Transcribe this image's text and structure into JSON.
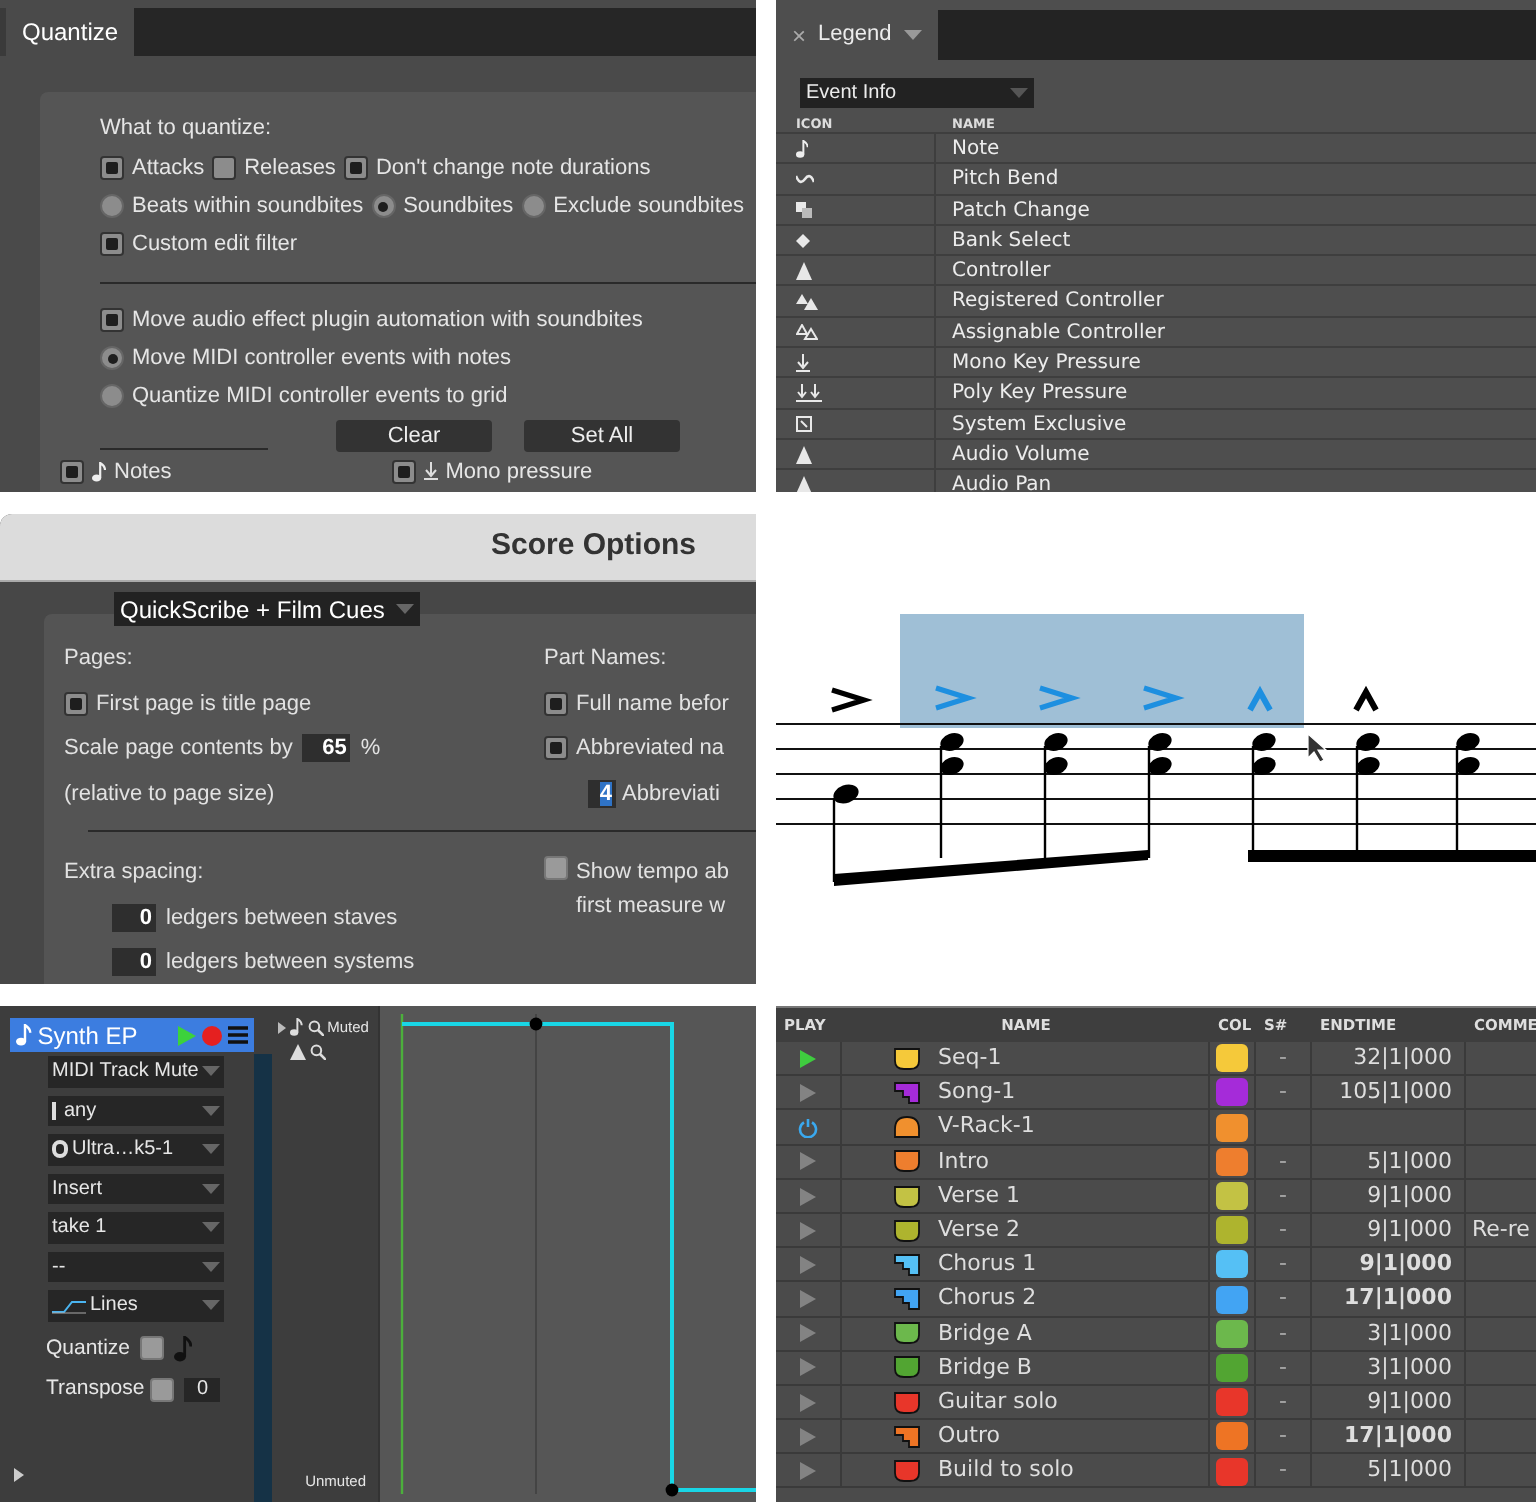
{
  "quantize": {
    "tab": "Quantize",
    "heading": "What to quantize:",
    "rows": [
      {
        "options": [
          {
            "kind": "checkbox",
            "label": "Attacks",
            "checked": true
          },
          {
            "kind": "checkbox",
            "label": "Releases",
            "checked": false
          },
          {
            "kind": "checkbox",
            "label": "Don't change note durations",
            "checked": true
          }
        ]
      },
      {
        "options": [
          {
            "kind": "radio",
            "label": "Beats within soundbites",
            "selected": false
          },
          {
            "kind": "radio",
            "label": "Soundbites",
            "selected": true
          },
          {
            "kind": "radio",
            "label": "Exclude soundbites",
            "selected": false
          }
        ]
      },
      {
        "options": [
          {
            "kind": "checkbox",
            "label": "Custom edit filter",
            "checked": true
          }
        ]
      }
    ],
    "rows_2": [
      {
        "options": [
          {
            "kind": "checkbox",
            "label": "Move audio effect plugin automation with soundbites",
            "checked": true
          }
        ]
      },
      {
        "options": [
          {
            "kind": "radio",
            "label": "Move MIDI controller events with notes",
            "selected": true
          }
        ]
      },
      {
        "options": [
          {
            "kind": "radio",
            "label": "Quantize MIDI controller events to grid",
            "selected": false
          }
        ]
      }
    ],
    "buttons": [
      "Clear",
      "Set All"
    ],
    "event_filters": [
      {
        "label": "Notes",
        "kind": "note",
        "checked": true
      },
      {
        "label": "Mono pressure",
        "kind": "mono",
        "checked": true
      }
    ]
  },
  "legend": {
    "tab": "Legend",
    "close": "×",
    "dropdown": "Event Info",
    "columns": [
      "ICON",
      "NAME"
    ],
    "rows": [
      {
        "kind": "note",
        "name": "Note"
      },
      {
        "kind": "bend",
        "name": "Pitch Bend"
      },
      {
        "kind": "patch",
        "name": "Patch Change"
      },
      {
        "kind": "diamond",
        "name": "Bank Select"
      },
      {
        "kind": "triangle",
        "name": "Controller"
      },
      {
        "kind": "registered",
        "name": "Registered Controller"
      },
      {
        "kind": "assignable",
        "name": "Assignable Controller"
      },
      {
        "kind": "mono",
        "name": "Mono Key Pressure"
      },
      {
        "kind": "poly",
        "name": "Poly Key Pressure"
      },
      {
        "kind": "sysex",
        "name": "System Exclusive"
      },
      {
        "kind": "triangle",
        "name": "Audio Volume"
      },
      {
        "kind": "triangle",
        "name": "Audio Pan"
      }
    ]
  },
  "score_options": {
    "title": "Score Options",
    "preset": "QuickScribe + Film Cues",
    "pages": {
      "heading": "Pages:",
      "first_page": {
        "label": "First page is title page",
        "checked": true
      },
      "scale_label": "Scale page contents by",
      "scale_value": "65",
      "scale_unit": "%",
      "scale_note": "(relative to page size)"
    },
    "part_names": {
      "heading": "Part Names:",
      "options": [
        {
          "label": "Full name befor",
          "checked": true
        },
        {
          "label": "Abbreviated na",
          "checked": true
        }
      ],
      "abbrev_value": "4",
      "abbrev_label": "Abbreviati"
    },
    "extra_spacing": {
      "heading": "Extra spacing:",
      "fields": [
        {
          "value": "0",
          "label": "ledgers between staves"
        },
        {
          "value": "0",
          "label": "ledgers between systems"
        }
      ]
    },
    "show_tempo": {
      "label": "Show tempo ab",
      "label_2": "first measure w",
      "checked": false
    }
  },
  "inspector": {
    "track": "Synth EP",
    "dropdowns": [
      {
        "kind": "plain",
        "value": "MIDI Track Mute"
      },
      {
        "kind": "input",
        "value": "any"
      },
      {
        "kind": "output",
        "value": "Ultra…k5-1"
      },
      {
        "kind": "plain",
        "value": "Insert"
      },
      {
        "kind": "plain",
        "value": "take 1"
      },
      {
        "kind": "plain",
        "value": "--"
      },
      {
        "kind": "lines",
        "value": "Lines"
      }
    ],
    "quantize": {
      "label": "Quantize",
      "checked": false
    },
    "transpose": {
      "label": "Transpose",
      "checked": false,
      "value": "0"
    },
    "muted": "Muted",
    "unmuted": "Unmuted"
  },
  "tracks": {
    "columns": [
      "PLAY",
      "NAME",
      "COL",
      "S#",
      "ENDTIME",
      "COMME"
    ],
    "rows": [
      {
        "play": {
          "kind": "play",
          "active": true
        },
        "clip": {
          "kind": "cup"
        },
        "name": "Seq-1",
        "color": "#f5c93a",
        "s": "-",
        "endtime": "32|1|000",
        "bold": false
      },
      {
        "play": {
          "kind": "play",
          "active": false
        },
        "clip": {
          "kind": "step"
        },
        "name": "Song-1",
        "color": "#a52bd9",
        "s": "-",
        "endtime": "105|1|000",
        "bold": false
      },
      {
        "play": {
          "kind": "power"
        },
        "clip": {
          "kind": "dome"
        },
        "name": "V-Rack-1",
        "color": "#f0902e"
      },
      {
        "play": {
          "kind": "play",
          "active": false
        },
        "clip": {
          "kind": "cup"
        },
        "name": "Intro",
        "color": "#ee7e2e",
        "s": "-",
        "endtime": "5|1|000",
        "bold": false
      },
      {
        "play": {
          "kind": "play",
          "active": false
        },
        "clip": {
          "kind": "cup"
        },
        "name": "Verse 1",
        "color": "#c3c244",
        "s": "-",
        "endtime": "9|1|000",
        "bold": false
      },
      {
        "play": {
          "kind": "play",
          "active": false
        },
        "clip": {
          "kind": "cup"
        },
        "name": "Verse 2",
        "color": "#aeb42e",
        "s": "-",
        "endtime": "9|1|000",
        "bold": false,
        "comment": "Re-re"
      },
      {
        "play": {
          "kind": "play",
          "active": false
        },
        "clip": {
          "kind": "step"
        },
        "name": "Chorus 1",
        "color": "#55c0f5",
        "s": "-",
        "endtime": "9|1|000",
        "bold": true
      },
      {
        "play": {
          "kind": "play",
          "active": false
        },
        "clip": {
          "kind": "step"
        },
        "name": "Chorus 2",
        "color": "#42a4f3",
        "s": "-",
        "endtime": "17|1|000",
        "bold": true
      },
      {
        "play": {
          "kind": "play",
          "active": false
        },
        "clip": {
          "kind": "cup"
        },
        "name": "Bridge A",
        "color": "#6cb84c",
        "s": "-",
        "endtime": "3|1|000",
        "bold": false
      },
      {
        "play": {
          "kind": "play",
          "active": false
        },
        "clip": {
          "kind": "cup"
        },
        "name": "Bridge B",
        "color": "#52a532",
        "s": "-",
        "endtime": "3|1|000",
        "bold": false
      },
      {
        "play": {
          "kind": "play",
          "active": false
        },
        "clip": {
          "kind": "cup"
        },
        "name": "Guitar solo",
        "color": "#e8362a",
        "s": "-",
        "endtime": "9|1|000",
        "bold": false
      },
      {
        "play": {
          "kind": "play",
          "active": false
        },
        "clip": {
          "kind": "step"
        },
        "name": "Outro",
        "color": "#ee7424",
        "s": "-",
        "endtime": "17|1|000",
        "bold": true
      },
      {
        "play": {
          "kind": "play",
          "active": false
        },
        "clip": {
          "kind": "cup"
        },
        "name": "Build to solo",
        "color": "#e8362a",
        "s": "-",
        "endtime": "5|1|000",
        "bold": false
      }
    ]
  }
}
